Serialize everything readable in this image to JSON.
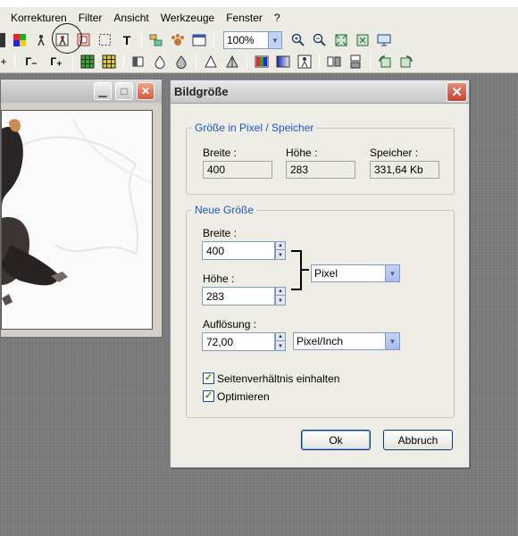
{
  "menu": [
    "Korrekturen",
    "Filter",
    "Ansicht",
    "Werkzeuge",
    "Fenster",
    "?"
  ],
  "toolbar": {
    "zoom": "100%",
    "text_tool_glyph": "T",
    "row2_tool1": "Г₋",
    "row2_tool2": "Г₊"
  },
  "dialog": {
    "title": "Bildgröße",
    "pixel_group": {
      "legend": "Größe in Pixel / Speicher",
      "width_label": "Breite :",
      "height_label": "Höhe :",
      "memory_label": "Speicher :",
      "width_value": "400",
      "height_value": "283",
      "memory_value": "331,64 Kb"
    },
    "new_size": {
      "legend": "Neue Größe",
      "width_label": "Breite :",
      "width_value": "400",
      "height_label": "Höhe :",
      "height_value": "283",
      "unit": "Pixel",
      "resolution_label": "Auflösung :",
      "resolution_value": "72,00",
      "resolution_unit": "Pixel/Inch",
      "keep_ratio_label": "Seitenverhältnis einhalten",
      "keep_ratio_checked": true,
      "optimize_label": "Optimieren",
      "optimize_checked": true
    },
    "ok_label": "Ok",
    "cancel_label": "Abbruch"
  },
  "colors": {
    "accent_legend": "#1b57c6",
    "close_red": "#c8402a",
    "check_green": "#21a121"
  }
}
